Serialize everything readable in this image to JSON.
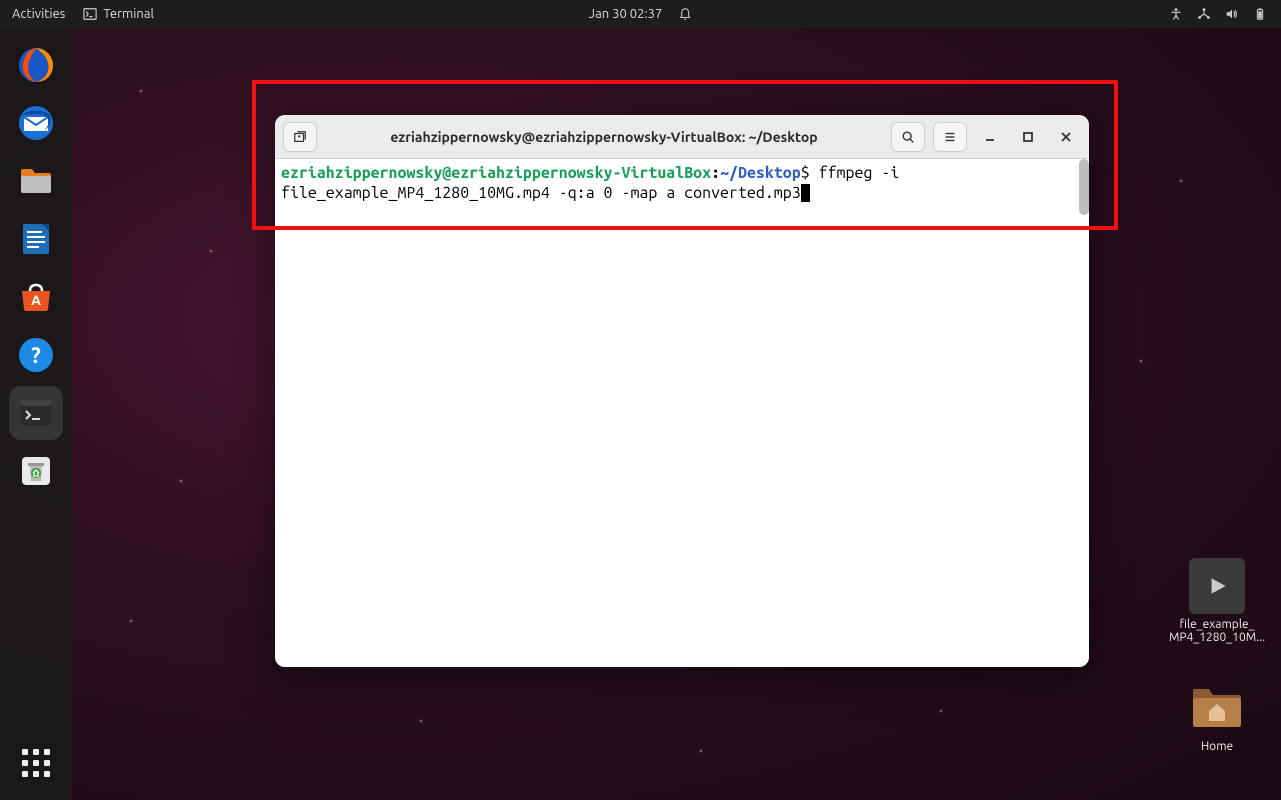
{
  "topbar": {
    "activities": "Activities",
    "app_indicator": "Terminal",
    "datetime": "Jan 30  02:37"
  },
  "dock": {
    "items": [
      {
        "name": "firefox"
      },
      {
        "name": "thunderbird"
      },
      {
        "name": "files"
      },
      {
        "name": "libreoffice-writer"
      },
      {
        "name": "ubuntu-software"
      },
      {
        "name": "help"
      },
      {
        "name": "terminal"
      },
      {
        "name": "trash"
      }
    ]
  },
  "desktop": {
    "file1": {
      "label_line1": "file_example_",
      "label_line2": "MP4_1280_10M..."
    },
    "home": {
      "label": "Home"
    }
  },
  "terminal": {
    "title": "ezriahzippernowsky@ezriahzippernowsky-VirtualBox: ~/Desktop",
    "prompt_user": "ezriahzippernowsky@ezriahzippernowsky-VirtualBox",
    "prompt_colon": ":",
    "prompt_path": "~/Desktop",
    "prompt_sign": "$",
    "command": "ffmpeg -i file_example_MP4_1280_10MG.mp4 -q:a 0 -map a converted.mp3"
  }
}
